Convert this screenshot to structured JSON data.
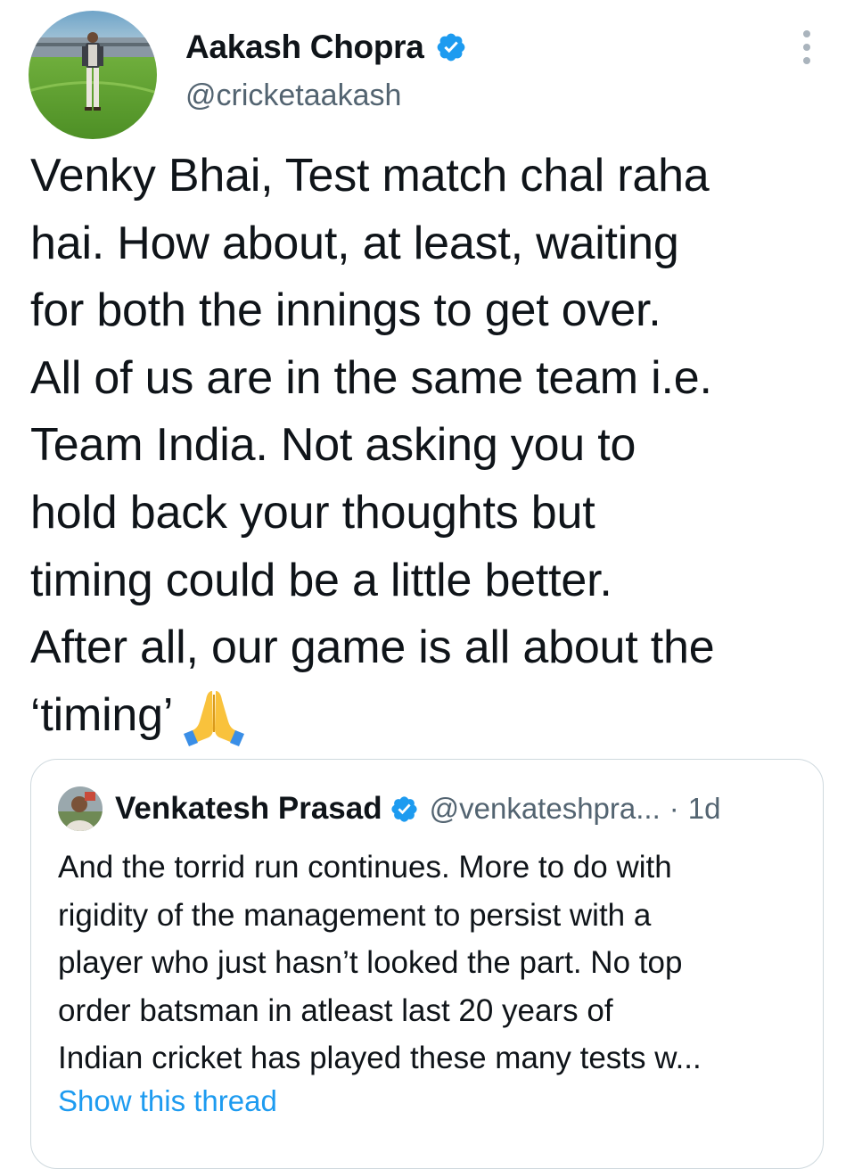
{
  "author": {
    "name": "Aakash Chopra",
    "handle": "@cricketaakash",
    "verified": true,
    "avatar_icon": "profile-photo-cricket-stadium"
  },
  "tweet": {
    "lines": [
      "Venky Bhai, Test match chal raha",
      "hai. How about, at least, waiting",
      "for both the innings to get over.",
      "All of us are in the same team i.e.",
      "Team India. Not asking you to",
      "hold back your thoughts but",
      "timing could be a little better.",
      "After all, our game is all about the",
      "‘timing’"
    ],
    "emoji": "folded-hands-emoji"
  },
  "quoted_tweet": {
    "name": "Venkatesh Prasad",
    "handle": "@venkateshpra...",
    "separator": "·",
    "time": "1d",
    "verified": true,
    "lines": [
      "And the torrid run continues. More to do with",
      "rigidity of the management to persist with a",
      "player who just hasn’t looked the part. No top",
      "order batsman in atleast last 20 years of",
      "Indian cricket has played these many tests w..."
    ],
    "show_thread_label": "Show this thread"
  },
  "colors": {
    "text": "#0f1419",
    "secondary": "#536471",
    "accent": "#1d9bf0",
    "border": "#cfd9de"
  }
}
